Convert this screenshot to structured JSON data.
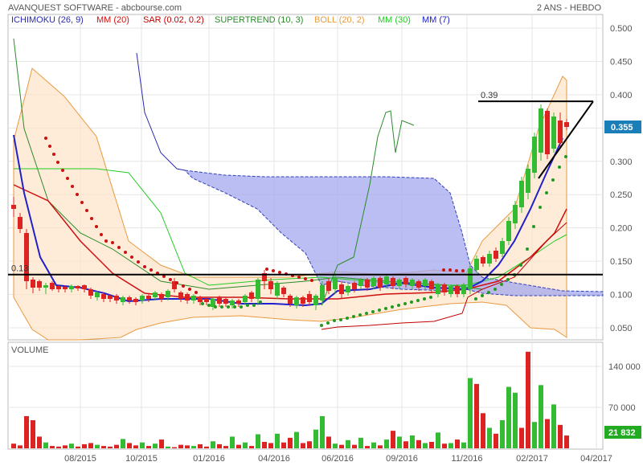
{
  "chart_data": [
    {
      "type": "candlestick",
      "title": "AVANQUEST SOFTWARE - abcbourse.com",
      "period_label": "2 ANS - HEBDO",
      "ylim": [
        0.03,
        0.52
      ],
      "y_ticks": [
        "0.500",
        "0.450",
        "0.400",
        "0.350",
        "0.300",
        "0.250",
        "0.200",
        "0.150",
        "0.100",
        "0.050"
      ],
      "y_tick_values": [
        0.5,
        0.45,
        0.4,
        0.35,
        0.3,
        0.25,
        0.2,
        0.15,
        0.1,
        0.05
      ],
      "last_price_label": "0.355",
      "last_price": 0.355,
      "legend": [
        {
          "label": "ICHIMOKU (26, 9)",
          "color": "#2a2ab0"
        },
        {
          "label": "MM (20)",
          "color": "#d01010"
        },
        {
          "label": "SAR (0.02, 0.2)",
          "color": "#c00000"
        },
        {
          "label": "SUPERTREND (10, 3)",
          "color": "#2a8a2a"
        },
        {
          "label": "BOLL (20, 2)",
          "color": "#e89a40"
        },
        {
          "label": "MM (30)",
          "color": "#22cc22"
        },
        {
          "label": "MM (7)",
          "color": "#2020cc"
        }
      ],
      "annotations": [
        {
          "text": "0.13",
          "value": 0.13
        },
        {
          "text": "0.39",
          "value": 0.39
        }
      ],
      "colors": {
        "up": "#33bb33",
        "down": "#dd2222",
        "support": "#000000"
      }
    },
    {
      "type": "bar",
      "title": "VOLUME",
      "ylim": [
        0,
        175000
      ],
      "y_ticks": [
        "140 000",
        "70 000"
      ],
      "y_tick_values": [
        140000,
        70000
      ],
      "last_value_label": "21 832",
      "last_value": 21832,
      "x_ticks": [
        "08/2015",
        "10/2015",
        "01/2016",
        "04/2016",
        "06/2016",
        "09/2016",
        "11/2016",
        "02/2017",
        "04/2017"
      ],
      "colors": {
        "up": "#33bb33",
        "down": "#dd2222"
      }
    }
  ]
}
